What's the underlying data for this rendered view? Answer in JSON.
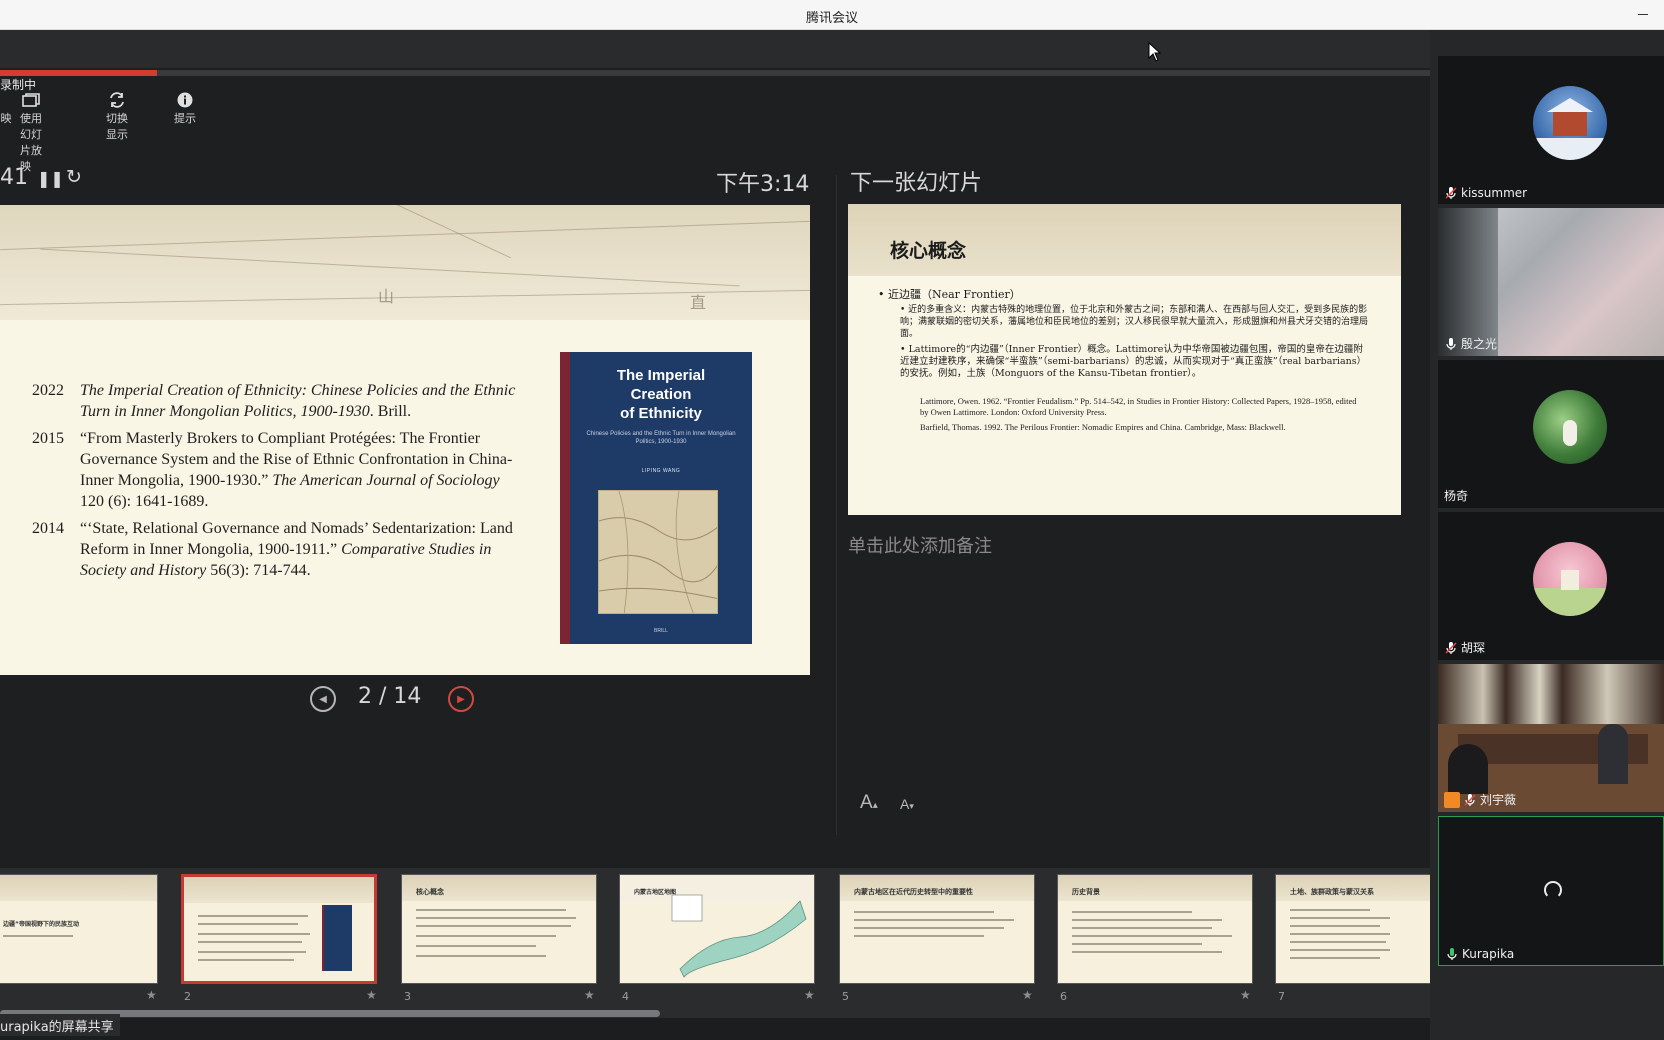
{
  "window": {
    "title": "腾讯会议"
  },
  "recording": {
    "label": "录制中",
    "progress": 0.11
  },
  "toolbar": {
    "items": [
      {
        "label": "映"
      },
      {
        "label": "使用幻灯片放映"
      },
      {
        "label": "切换显示"
      },
      {
        "label": "提示"
      }
    ]
  },
  "presenter": {
    "timer": "41",
    "clock": "下午3:14",
    "slide_counter": "2 / 14",
    "next_heading": "下一张幻灯片",
    "notes_placeholder": "单击此处添加备注",
    "font_up": "A",
    "font_down": "A"
  },
  "current_slide": {
    "map_chars": [
      "山",
      "直"
    ],
    "publications": [
      {
        "year": "2022",
        "italic": "The Imperial Creation of Ethnicity: Chinese Policies and the Ethnic Turn in Inner Mongolian Politics, 1900-1930",
        "rest": ". Brill."
      },
      {
        "year": "2015",
        "text": "“From Masterly Brokers to Compliant Protégées: The Frontier Governance System and the Rise of Ethnic Confrontation in China-Inner Mongolia, 1900-1930.”",
        "italic": "The American Journal of Sociology",
        "rest": "120 (6): 1641-1689."
      },
      {
        "year": "2014",
        "text": "“‘State, Relational Governance and Nomads’ Sedentarization: Land Reform in Inner Mongolia, 1900-1911.”",
        "italic": "Comparative Studies in Society and History",
        "rest": "56(3): 714-744."
      }
    ],
    "book": {
      "title": "The Imperial\nCreation\nof Ethnicity",
      "subtitle": "Chinese Policies and the Ethnic Turn in Inner Mongolian Politics, 1900-1930",
      "author": "LIPING WANG",
      "publisher": "BRILL"
    }
  },
  "next_slide": {
    "title": "核心概念",
    "bullet1": "• 近边疆（Near Frontier）",
    "sub1": "• 近的多重含义：内蒙古特殊的地理位置，位于北京和外蒙古之间；东部和满人、在西部与回人交汇，受到多民族的影响；满蒙联姻的密切关系，藩属地位和臣民地位的差别；汉人移民很早就大量流入，形成盟旗和州县犬牙交错的治理局面。",
    "sub2": "• Lattimore的“内边疆”（Inner Frontier）概念。Lattimore认为中华帝国被边疆包围，帝国的皇帝在边疆附近建立封建秩序，来确保“半蛮族”（semi-barbarians）的忠诚，从而实现对于“真正蛮族”（real barbarians）的安抚。例如，土族（Monguors of the Kansu-Tibetan frontier）。",
    "ref1": "Lattimore, Owen. 1962. “Frontier Feudalism.” Pp. 514–542, in Studies in Frontier History: Collected Papers, 1928–1958, edited by Owen Lattimore. London: Oxford University Press.",
    "ref2": "Barfield, Thomas. 1992. The Perilous Frontier: Nomadic Empires and China. Cambridge, Mass: Blackwell."
  },
  "thumbnails": [
    {
      "num": "",
      "title": "边疆”帝国视野下的民族互动"
    },
    {
      "num": "2",
      "title": ""
    },
    {
      "num": "3",
      "title": "核心概念"
    },
    {
      "num": "4",
      "title": "内蒙古地区地图"
    },
    {
      "num": "5",
      "title": "内蒙古地区在近代历史转型中的重要性"
    },
    {
      "num": "6",
      "title": "历史背景"
    },
    {
      "num": "7",
      "title": "土地、族群政策与蒙汉关系"
    }
  ],
  "share_label": "urapika的屏幕共享",
  "participants": [
    {
      "name": "kissummer",
      "mic": "muted"
    },
    {
      "name": "殷之光",
      "mic": "on"
    },
    {
      "name": "杨奇",
      "mic": "none"
    },
    {
      "name": "胡琛",
      "mic": "muted"
    },
    {
      "name": "刘宇薇",
      "mic": "muted"
    },
    {
      "name": "Kurapika",
      "mic": "speaking"
    }
  ],
  "colors": {
    "accent_red": "#d23d32",
    "active_green": "#2f9a54",
    "stage_bg": "#1e1f21"
  }
}
